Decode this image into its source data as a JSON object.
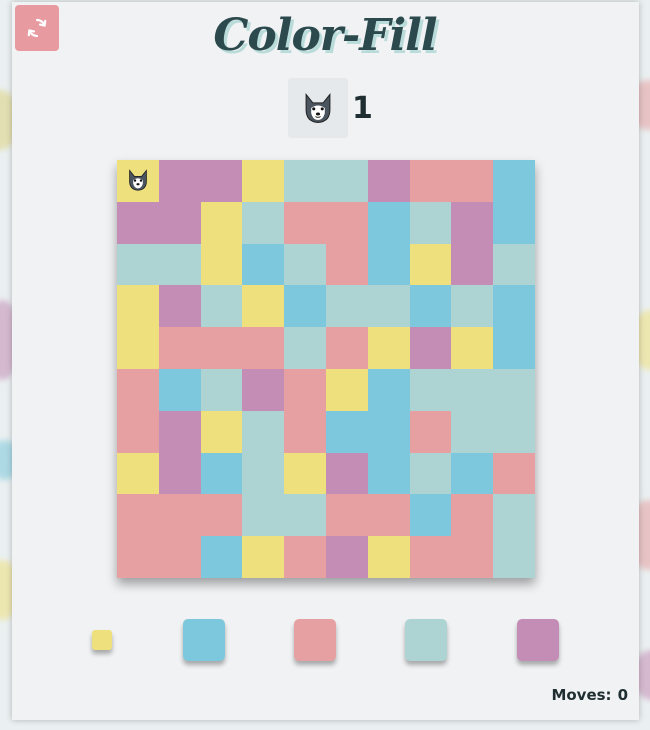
{
  "title": "Color-Fill",
  "level": {
    "icon": "husky-icon",
    "value": "1"
  },
  "reset_button": {
    "icon": "refresh-icon",
    "color": "#e79aa0"
  },
  "colors": {
    "yellow": "#efe07e",
    "blue": "#7dc8dc",
    "pink": "#e6a0a2",
    "teal": "#aed3d3",
    "purple": "#c48db5"
  },
  "board": {
    "size": 10,
    "player_icon": "husky-icon",
    "cells": [
      [
        "yellow",
        "purple",
        "purple",
        "yellow",
        "teal",
        "teal",
        "purple",
        "pink",
        "pink",
        "blue"
      ],
      [
        "purple",
        "purple",
        "yellow",
        "teal",
        "pink",
        "pink",
        "blue",
        "teal",
        "purple",
        "blue"
      ],
      [
        "teal",
        "teal",
        "yellow",
        "blue",
        "teal",
        "pink",
        "blue",
        "yellow",
        "purple",
        "teal"
      ],
      [
        "yellow",
        "purple",
        "teal",
        "yellow",
        "blue",
        "teal",
        "teal",
        "blue",
        "teal",
        "blue"
      ],
      [
        "yellow",
        "pink",
        "pink",
        "pink",
        "teal",
        "pink",
        "yellow",
        "purple",
        "yellow",
        "blue"
      ],
      [
        "pink",
        "blue",
        "teal",
        "purple",
        "pink",
        "yellow",
        "blue",
        "teal",
        "teal",
        "teal"
      ],
      [
        "pink",
        "purple",
        "yellow",
        "teal",
        "pink",
        "blue",
        "blue",
        "pink",
        "teal",
        "teal"
      ],
      [
        "yellow",
        "purple",
        "blue",
        "teal",
        "yellow",
        "purple",
        "blue",
        "teal",
        "blue",
        "pink"
      ],
      [
        "pink",
        "pink",
        "pink",
        "teal",
        "teal",
        "pink",
        "pink",
        "blue",
        "pink",
        "teal"
      ],
      [
        "pink",
        "pink",
        "blue",
        "yellow",
        "pink",
        "purple",
        "yellow",
        "pink",
        "pink",
        "teal"
      ]
    ]
  },
  "palette": [
    {
      "color": "yellow",
      "selected": true
    },
    {
      "color": "blue",
      "selected": false
    },
    {
      "color": "pink",
      "selected": false
    },
    {
      "color": "teal",
      "selected": false
    },
    {
      "color": "purple",
      "selected": false
    }
  ],
  "moves": {
    "label": "Moves:",
    "value": "0"
  }
}
